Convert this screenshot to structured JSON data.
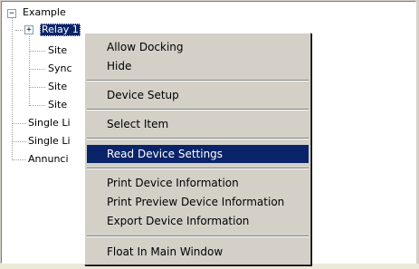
{
  "tree": {
    "root_label": "Example",
    "root_expander": "−",
    "children": [
      {
        "label": "Relay 1",
        "expander": "+"
      },
      {
        "label": "Site"
      },
      {
        "label": "Sync"
      },
      {
        "label": "Site"
      },
      {
        "label": "Site"
      },
      {
        "label": "Single Li"
      },
      {
        "label": "Single Li"
      },
      {
        "label": "Annunci"
      }
    ]
  },
  "context_menu": {
    "items": [
      {
        "label": "Allow Docking"
      },
      {
        "label": "Hide"
      },
      {
        "label": "Device Setup"
      },
      {
        "label": "Select Item"
      },
      {
        "label": "Read Device Settings",
        "highlighted": true
      },
      {
        "label": "Print Device Information"
      },
      {
        "label": "Print Preview Device Information"
      },
      {
        "label": "Export Device Information"
      },
      {
        "label": "Float In Main Window"
      }
    ]
  },
  "colors": {
    "selection": "#0a246a",
    "menu_background": "#d4d0c8",
    "tree_background": "#ffffff"
  }
}
